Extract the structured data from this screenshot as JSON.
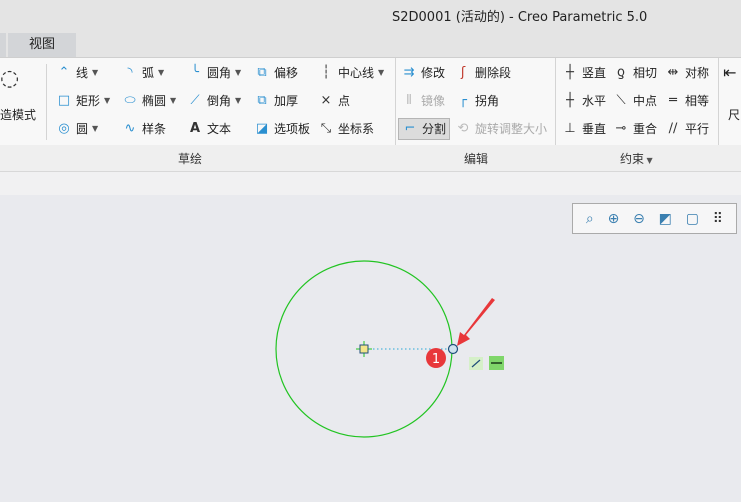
{
  "window": {
    "title": "S2D0001 (活动的) - Creo Parametric 5.0"
  },
  "tabs": [
    {
      "label": "视图"
    }
  ],
  "sketch_group": {
    "label": "草绘",
    "mode_label": "造模式",
    "items": [
      {
        "label": "线",
        "icon": "line-icon",
        "dropdown": true
      },
      {
        "label": "矩形",
        "icon": "rectangle-icon",
        "dropdown": true
      },
      {
        "label": "圆",
        "icon": "circle-icon",
        "dropdown": true
      },
      {
        "label": "弧",
        "icon": "arc-icon",
        "dropdown": true
      },
      {
        "label": "椭圆",
        "icon": "ellipse-icon",
        "dropdown": true
      },
      {
        "label": "样条",
        "icon": "spline-icon"
      },
      {
        "label": "圆角",
        "icon": "fillet-icon",
        "dropdown": true
      },
      {
        "label": "倒角",
        "icon": "chamfer-icon",
        "dropdown": true
      },
      {
        "label": "文本",
        "icon": "text-icon"
      },
      {
        "label": "偏移",
        "icon": "offset-icon"
      },
      {
        "label": "加厚",
        "icon": "thicken-icon"
      },
      {
        "label": "选项板",
        "icon": "palette-icon"
      },
      {
        "label": "中心线",
        "icon": "centerline-icon",
        "dropdown": true
      },
      {
        "label": "点",
        "icon": "point-icon"
      },
      {
        "label": "坐标系",
        "icon": "coordinate-system-icon"
      }
    ]
  },
  "edit_group": {
    "label": "编辑",
    "items": [
      {
        "label": "修改",
        "icon": "modify-icon"
      },
      {
        "label": "删除段",
        "icon": "delete-segment-icon"
      },
      {
        "label": "镜像",
        "icon": "mirror-icon",
        "disabled": true
      },
      {
        "label": "拐角",
        "icon": "corner-icon"
      },
      {
        "label": "分割",
        "icon": "divide-icon",
        "active": true
      },
      {
        "label": "旋转调整大小",
        "icon": "rotate-resize-icon",
        "disabled": true
      }
    ]
  },
  "constrain_group": {
    "label": "约束",
    "items": [
      {
        "label": "竖直",
        "icon": "vertical-icon"
      },
      {
        "label": "水平",
        "icon": "horizontal-icon"
      },
      {
        "label": "垂直",
        "icon": "perpendicular-icon"
      },
      {
        "label": "相切",
        "icon": "tangent-icon"
      },
      {
        "label": "中点",
        "icon": "midpoint-icon"
      },
      {
        "label": "重合",
        "icon": "coincident-icon"
      },
      {
        "label": "对称",
        "icon": "symmetric-icon"
      },
      {
        "label": "相等",
        "icon": "equal-icon"
      },
      {
        "label": "平行",
        "icon": "parallel-icon"
      }
    ]
  },
  "dimension_group": {
    "label": "尺"
  },
  "view_toolbar": [
    "refit-icon",
    "zoom-in-icon",
    "zoom-out-icon",
    "repaint-icon",
    "display-style-icon",
    "sketcher-display-icon"
  ],
  "annotation": {
    "step": "1"
  },
  "colors": {
    "sketch": "#22c422",
    "annotation": "#e8373a",
    "accent": "#2a8fd0"
  }
}
